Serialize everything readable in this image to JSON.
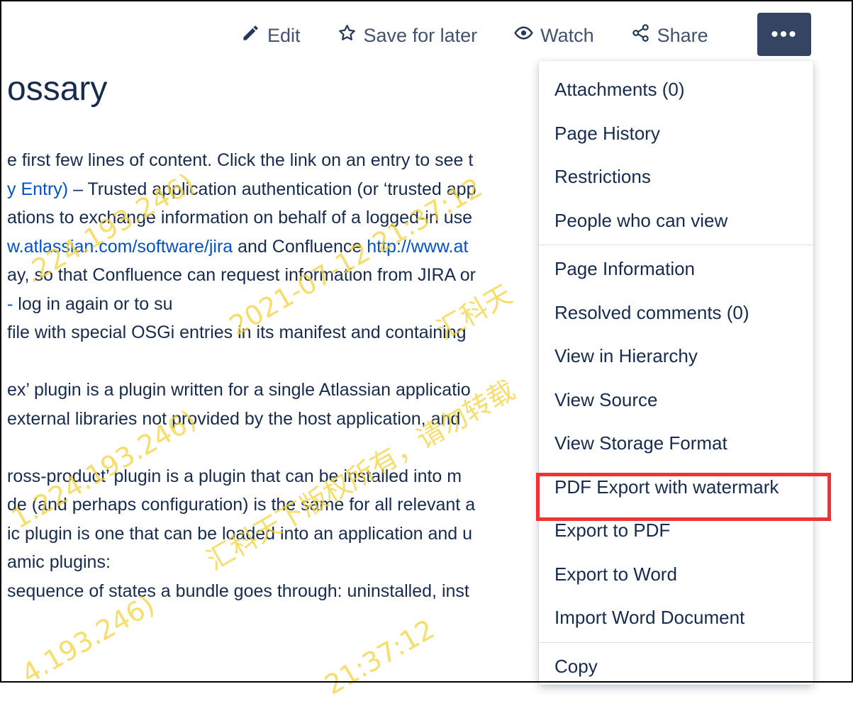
{
  "toolbar": {
    "edit": "Edit",
    "save_for_later": "Save for later",
    "watch": "Watch",
    "share": "Share",
    "more": "•••"
  },
  "page": {
    "title": "ossary",
    "lines": [
      "e first few lines of content. Click the link on an entry to see t",
      "y Entry) – Trusted application authentication (or ‘trusted app",
      "ations to exchange information on behalf of a logged-in use",
      "w.atlassian.com/software/jira and Confluence http://www.at",
      "ay, so that Confluence can request information from JIRA or",
      "log in again or to su",
      "file with special OSGi entries in its manifest and containing",
      "",
      "ex’ plugin is a plugin written for a single Atlassian applicatio",
      " external libraries not provided by the host application, and",
      "",
      "ross-product’ plugin is a plugin that can be installed into m",
      "de (and perhaps configuration) is the same for all relevant a",
      "ic plugin is one that can be loaded into an application and u",
      "amic plugins:",
      " sequence of states a bundle goes through: uninstalled, inst"
    ],
    "link_1": "y Entry)",
    "line_1_rest": " – Trusted application authentication (or ‘trusted app",
    "link_3a": "w.atlassian.com/software/jira",
    "line_3_mid": " and Confluence ",
    "link_3b": "http://www.at",
    "link_5": "-",
    "line_5_rest": " log in again or to su"
  },
  "watermarks": [
    ".224.193.246)",
    "2021-07-12 21:37:12",
    "汇科天",
    "4.193.246)",
    "汇科天下版权所有，请勿转载",
    "1.224.193.246)",
    "21:37:12"
  ],
  "menu": {
    "group1": [
      "Attachments (0)",
      "Page History",
      "Restrictions",
      "People who can view"
    ],
    "group2": [
      "Page Information",
      "Resolved comments (0)",
      "View in Hierarchy",
      "View Source",
      "View Storage Format",
      "PDF Export with watermark",
      "Export to PDF",
      "Export to Word",
      "Import Word Document"
    ],
    "group3": [
      "Copy"
    ]
  },
  "colors": {
    "accent": "#344563",
    "link": "#0052cc",
    "highlight": "#f03232",
    "watermark": "#f4d33b"
  }
}
